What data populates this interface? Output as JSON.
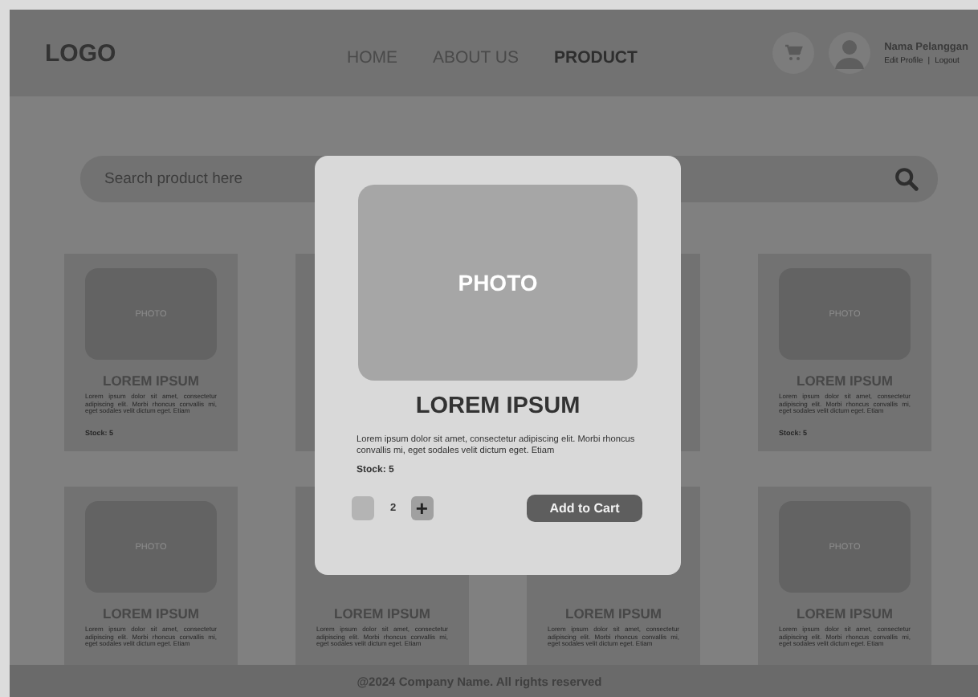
{
  "header": {
    "logo": "LOGO",
    "nav": [
      {
        "label": "HOME",
        "selected": false
      },
      {
        "label": "ABOUT US",
        "selected": false
      },
      {
        "label": "PRODUCT",
        "selected": true
      }
    ],
    "user": {
      "name": "Nama Pelanggan",
      "links": [
        "Edit Profile",
        "Logout"
      ],
      "separator": "|"
    }
  },
  "search": {
    "placeholder": "Search product here"
  },
  "products": [
    {
      "kind": "product",
      "photo": "PHOTO",
      "title": "LOREM IPSUM",
      "description": "Lorem ipsum dolor sit amet, consectetur adipiscing elit. Morbi rhoncus convallis mi, eget sodales velit dictum eget. Etiam",
      "stock": "Stock: 5"
    },
    {
      "kind": "blank"
    },
    {
      "kind": "blank"
    },
    {
      "kind": "product",
      "photo": "PHOTO",
      "title": "LOREM IPSUM",
      "description": "Lorem ipsum dolor sit amet, consectetur adipiscing elit. Morbi rhoncus convallis mi, eget sodales velit dictum eget. Etiam",
      "stock": "Stock: 5"
    },
    {
      "kind": "product",
      "photo": "PHOTO",
      "title": "LOREM IPSUM",
      "description": "Lorem ipsum dolor sit amet, consectetur adipiscing elit. Morbi rhoncus convallis mi, eget sodales velit dictum eget. Etiam"
    },
    {
      "kind": "product",
      "title": "LOREM IPSUM",
      "description": "Lorem ipsum dolor sit amet, consectetur adipiscing elit. Morbi rhoncus convallis mi, eget sodales velit dictum eget. Etiam"
    },
    {
      "kind": "product",
      "title": "LOREM IPSUM",
      "description": "Lorem ipsum dolor sit amet, consectetur adipiscing elit. Morbi rhoncus convallis mi, eget sodales velit dictum eget. Etiam"
    },
    {
      "kind": "product",
      "photo": "PHOTO",
      "title": "LOREM IPSUM",
      "description": "Lorem ipsum dolor sit amet, consectetur adipiscing elit. Morbi rhoncus convallis mi, eget sodales velit dictum eget. Etiam"
    }
  ],
  "modal": {
    "photo": "PHOTO",
    "title": "LOREM IPSUM",
    "description": "Lorem ipsum dolor sit amet, consectetur adipiscing elit. Morbi rhoncus convallis mi, eget sodales velit dictum eget. Etiam",
    "stock": "Stock: 5",
    "quantity": "2",
    "plus": "+",
    "button": "Add to Cart"
  },
  "footer": {
    "text": "@2024 Company Name. All rights reserved"
  }
}
